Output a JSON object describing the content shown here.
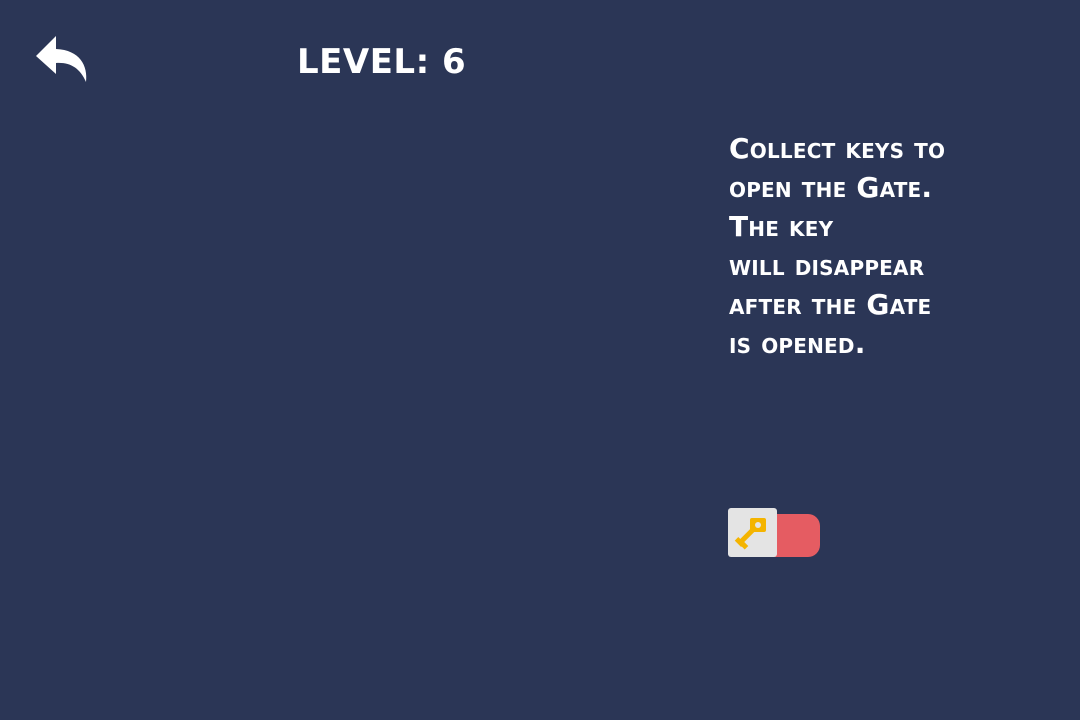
{
  "hud": {
    "back_icon": "back-arrow-icon",
    "level_text": "LEVEL: 6"
  },
  "instructions": {
    "lines": [
      "Collect keys to",
      "open the Gate.",
      "The key",
      "will disappear",
      "after the Gate",
      "is opened."
    ]
  },
  "inventory": {
    "key_icon": "key-icon",
    "key_color": "#f4b400",
    "slot_color": "#e55c62"
  },
  "colors": {
    "background": "#2b3656",
    "text": "#ffffff"
  }
}
